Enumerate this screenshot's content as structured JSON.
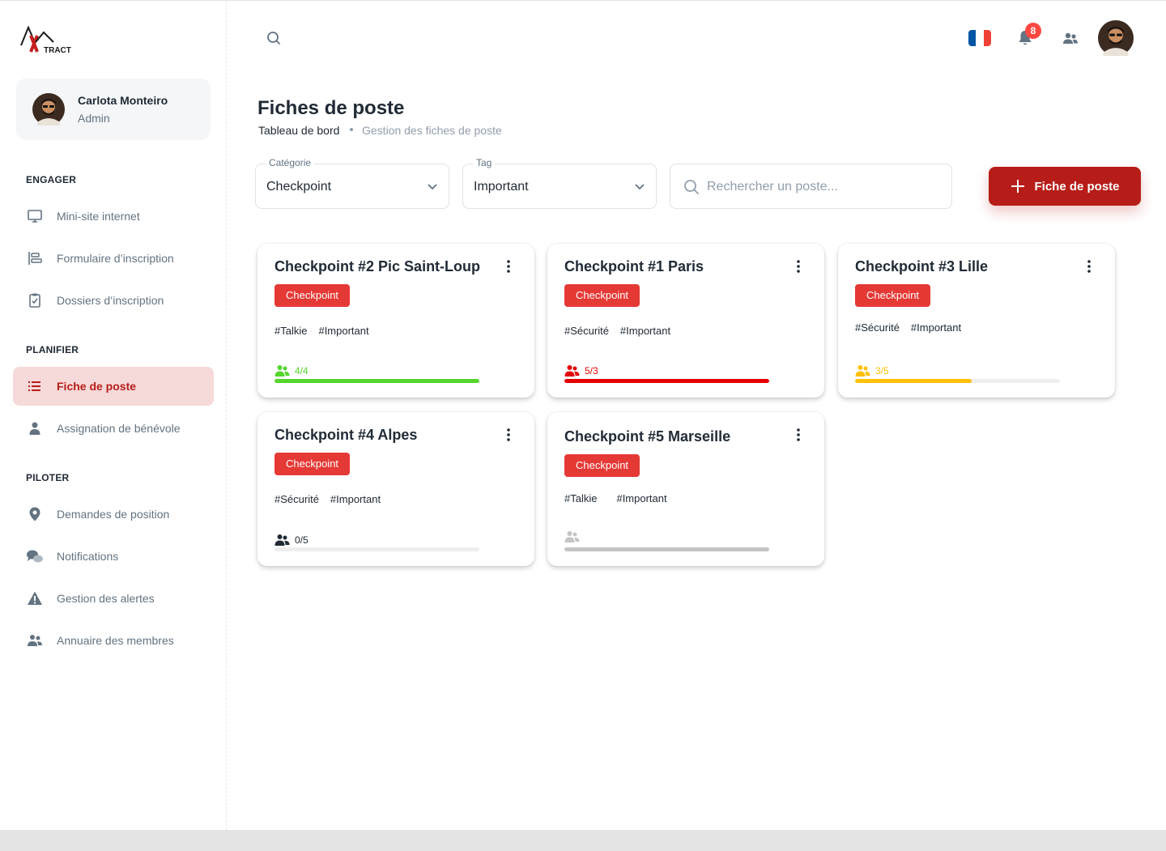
{
  "logo": {
    "text": "TRACT"
  },
  "account": {
    "name": "Carlota Monteiro",
    "role": "Admin"
  },
  "nav": {
    "sections": {
      "engager": "ENGAGER",
      "planifier": "PLANIFIER",
      "piloter": "PILOTER"
    },
    "items": [
      {
        "label": "Mini-site internet",
        "icon": "monitor-icon"
      },
      {
        "label": "Formulaire d’inscription",
        "icon": "form-icon"
      },
      {
        "label": "Dossiers d’inscription",
        "icon": "clipboard-icon"
      },
      {
        "label": "Fiche de poste",
        "icon": "list-icon",
        "active": true
      },
      {
        "label": "Assignation de bénévole",
        "icon": "person-icon"
      },
      {
        "label": "Demandes de position",
        "icon": "location-pin-icon"
      },
      {
        "label": "Notifications",
        "icon": "chat-bubbles-icon"
      },
      {
        "label": "Gestion des alertes",
        "icon": "warning-icon"
      },
      {
        "label": "Annuaire des membres",
        "icon": "people-icon"
      }
    ]
  },
  "header": {
    "notifications_count": "8",
    "language": "FR",
    "flag_colors": [
      "#0055a4",
      "#ffffff",
      "#ef4135"
    ]
  },
  "page": {
    "title": "Fiches de poste",
    "breadcrumb_home": "Tableau de bord",
    "breadcrumb_current": "Gestion des fiches de poste"
  },
  "filters": {
    "category": {
      "legend": "Catégorie",
      "value": "Checkpoint"
    },
    "tag": {
      "legend": "Tag",
      "value": "Important"
    },
    "search": {
      "placeholder": "Rechercher un poste..."
    },
    "add_button": "Fiche de poste"
  },
  "colors": {
    "accent": "#b71d18",
    "chip": "#e53935",
    "green": "#54d62c",
    "red": "#e40000",
    "yellow": "#ffc107",
    "dark": "#212b36",
    "gray": "#c4c4c4"
  },
  "cards": [
    {
      "title": "Checkpoint #2 Pic Saint-Loup",
      "chip": "Checkpoint",
      "tags": [
        "#Talkie",
        "#Important"
      ],
      "capacity": "4/4",
      "fill_ratio": 1.0,
      "status_color": "#54d62c"
    },
    {
      "title": "Checkpoint #1 Paris",
      "chip": "Checkpoint",
      "tags": [
        "#Sécurité",
        "#Important"
      ],
      "capacity": "5/3",
      "fill_ratio": 1.0,
      "status_color": "#e40000"
    },
    {
      "title": "Checkpoint #3 Lille",
      "chip": "Checkpoint",
      "tags": [
        "#Sécurité",
        "#Important"
      ],
      "capacity": "3/5",
      "fill_ratio": 0.57,
      "status_color": "#ffc107"
    },
    {
      "title": "Checkpoint #4 Alpes",
      "chip": "Checkpoint",
      "tags": [
        "#Sécurité",
        "#Important"
      ],
      "capacity": "0/5",
      "fill_ratio": 0.0,
      "status_color": "#212b36"
    },
    {
      "title": "Checkpoint #5 Marseille",
      "chip": "Checkpoint",
      "tags": [
        "#Talkie",
        "#Important"
      ],
      "capacity": "",
      "fill_ratio": 1.0,
      "status_color": "#c4c4c4"
    }
  ]
}
